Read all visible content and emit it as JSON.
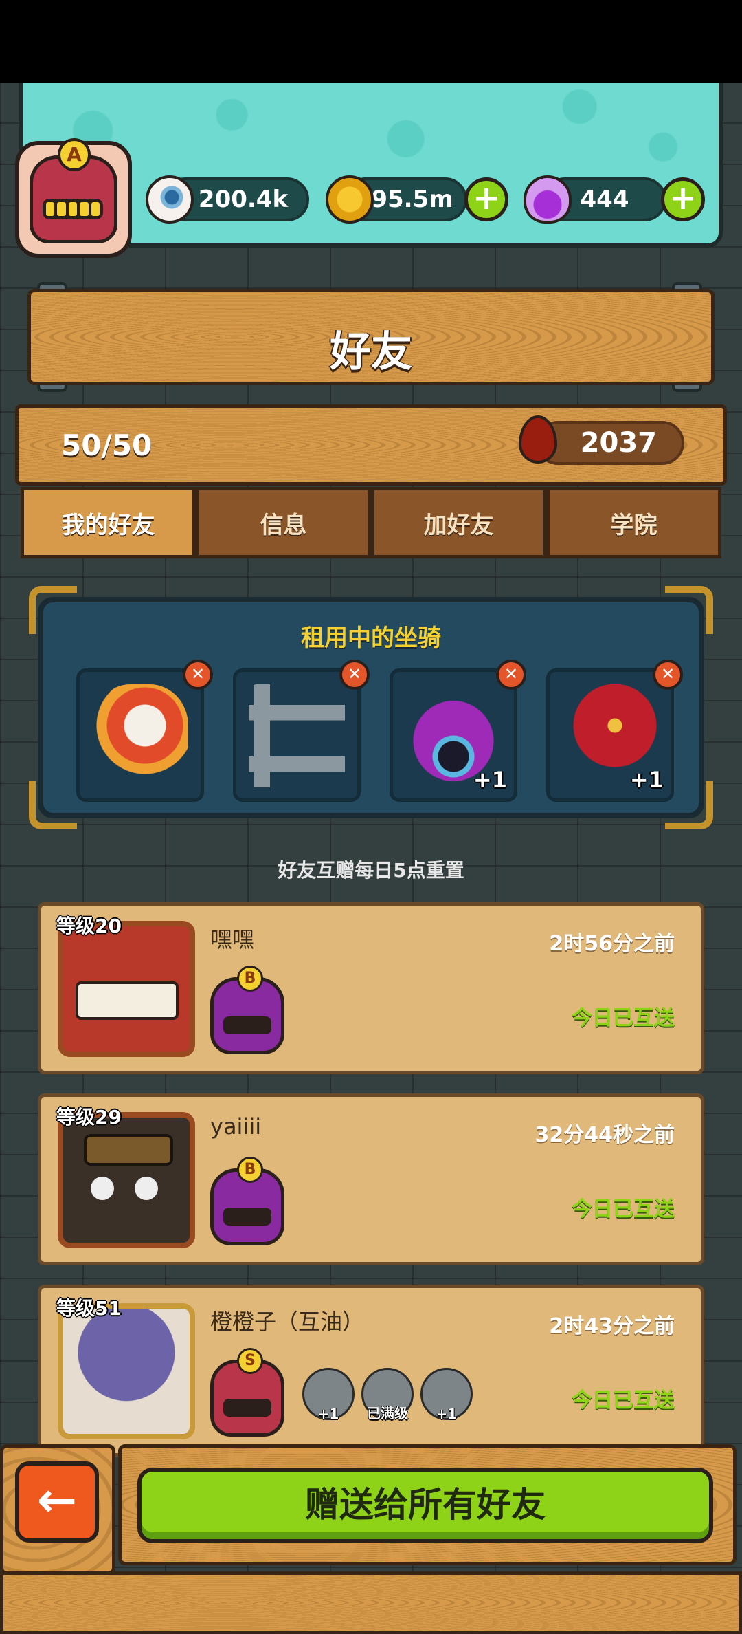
{
  "header": {
    "player_rank": "A",
    "eyeball_amount": "200.4k",
    "coin_amount": "95.5m",
    "potion_amount": "444",
    "plus_symbol": "+"
  },
  "title": "好友",
  "stats": {
    "friend_count": "50/50",
    "blood_amount": "2037"
  },
  "tabs": [
    "我的好友",
    "信息",
    "加好友",
    "学院"
  ],
  "active_tab": 0,
  "mounts": {
    "title": "租用中的坐骑",
    "remove_symbol": "✕",
    "slots": [
      {
        "icon": "lion-dance-mount-icon",
        "badge": ""
      },
      {
        "icon": "machine-mount-icon",
        "badge": ""
      },
      {
        "icon": "purple-monster-mount-icon",
        "badge": "+1"
      },
      {
        "icon": "red-rose-mount-icon",
        "badge": "+1"
      }
    ]
  },
  "notice": "好友互赠每日5点重置",
  "friends": [
    {
      "level": "等级20",
      "name": "嘿嘿",
      "time": "2时56分之前",
      "status": "今日已互送",
      "rank": "B",
      "avatar_color": "#b8382a",
      "mounts": []
    },
    {
      "level": "等级29",
      "name": "yaiiii",
      "time": "32分44秒之前",
      "status": "今日已互送",
      "rank": "B",
      "avatar_color": "#3b3028",
      "mounts": []
    },
    {
      "level": "等级51",
      "name": "橙橙子（互油）",
      "time": "2时43分之前",
      "status": "今日已互送",
      "rank": "S",
      "avatar_color": "#6c63a8",
      "mounts": [
        {
          "icon": "grey-monster-mount-icon",
          "label": "+1"
        },
        {
          "icon": "grey-rose-mount-icon",
          "label": "已满级"
        },
        {
          "icon": "grey-lion-mount-icon",
          "label": "+1"
        }
      ]
    }
  ],
  "footer": {
    "back_symbol": "←",
    "gift_all_label": "赠送给所有好友"
  },
  "colors": {
    "accent_green": "#8ed317",
    "teal": "#6fdad0",
    "wood": "#d69a4a",
    "card": "#e0b97a",
    "mount_panel": "#234a5f",
    "back_button": "#f0591e"
  }
}
